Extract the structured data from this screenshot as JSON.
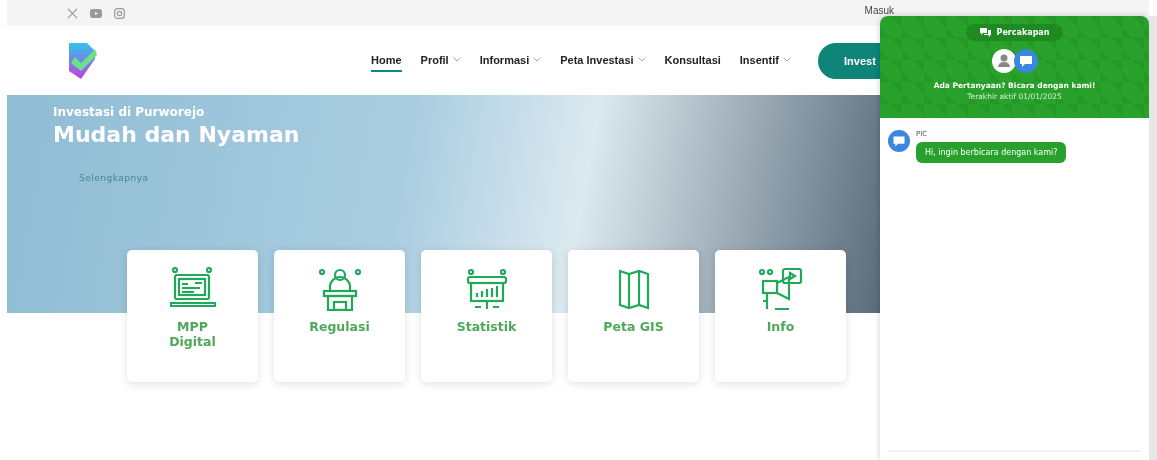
{
  "topbar": {
    "social": [
      {
        "kind": "x"
      },
      {
        "kind": "youtube"
      },
      {
        "kind": "instagram"
      }
    ],
    "login": "Masuk"
  },
  "nav": {
    "items": [
      {
        "label": "Home",
        "selected": true,
        "dropdown": false
      },
      {
        "label": "Profil",
        "selected": false,
        "dropdown": true
      },
      {
        "label": "Informasi",
        "selected": false,
        "dropdown": true
      },
      {
        "label": "Peta Investasi",
        "selected": false,
        "dropdown": true
      },
      {
        "label": "Konsultasi",
        "selected": false,
        "dropdown": false
      },
      {
        "label": "Insentif",
        "selected": false,
        "dropdown": true
      }
    ],
    "cta": "Invest"
  },
  "hero": {
    "subtitle": "Investasi di Purworejo",
    "title": "Mudah dan Nyaman",
    "link": "Selengkapnya"
  },
  "services": [
    {
      "kind": "laptop",
      "label": "MPP Digital"
    },
    {
      "kind": "podium",
      "label": "Regulasi"
    },
    {
      "kind": "board",
      "label": "Statistik"
    },
    {
      "kind": "map",
      "label": "Peta GIS"
    },
    {
      "kind": "megaphone",
      "label": "Info"
    }
  ],
  "chat": {
    "tab": "Percakapan",
    "heading": "Ada Pertanyaan? Bicara dengan kami!",
    "last_active": "Terakhir aktif 01/01/2025",
    "messages": [
      {
        "sender": "PIC",
        "text": "Hi, ingin berbicara dengan kami?"
      }
    ]
  }
}
